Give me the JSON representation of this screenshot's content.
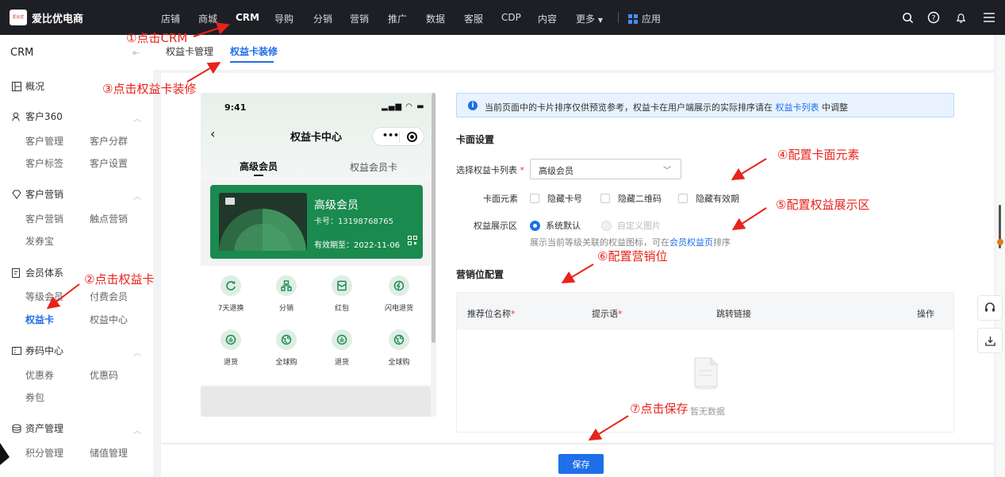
{
  "brand": {
    "logo_text": "爱比优",
    "name": "爱比优电商"
  },
  "topnav": {
    "items": [
      "店铺",
      "商城",
      "CRM",
      "导购",
      "分销",
      "营销",
      "推广",
      "数据",
      "客服",
      "CDP",
      "内容",
      "更多"
    ],
    "active": "CRM",
    "apps_label": "应用",
    "icons": [
      "search-icon",
      "help-icon",
      "bell-icon",
      "menu-icon"
    ]
  },
  "sidebar": {
    "title": "CRM",
    "groups": [
      {
        "label": "概况",
        "icon": "dashboard-icon",
        "items": []
      },
      {
        "label": "客户360",
        "icon": "user-icon",
        "items": [
          "客户管理",
          "客户分群",
          "客户标签",
          "客户设置"
        ]
      },
      {
        "label": "客户营销",
        "icon": "diamond-icon",
        "items": [
          "客户营销",
          "触点营销",
          "发券宝"
        ]
      },
      {
        "label": "会员体系",
        "icon": "member-icon",
        "items": [
          "等级会员",
          "付费会员",
          "权益卡",
          "权益中心"
        ]
      },
      {
        "label": "券码中心",
        "icon": "coupon-icon",
        "items": [
          "优惠券",
          "优惠码",
          "券包"
        ]
      },
      {
        "label": "资产管理",
        "icon": "asset-icon",
        "items": [
          "积分管理",
          "储值管理"
        ]
      }
    ],
    "active_item": "权益卡"
  },
  "tabs": [
    "权益卡管理",
    "权益卡装修"
  ],
  "active_tab": "权益卡装修",
  "phone": {
    "time": "9:41",
    "title": "权益卡中心",
    "tabs": [
      "高级会员",
      "权益会员卡"
    ],
    "card": {
      "name": "高级会员",
      "number": "卡号：13198768765",
      "expiry": "有效期至：2022-11-06"
    },
    "benefits": [
      "7天退换",
      "分销",
      "红包",
      "闪电退货",
      "退货",
      "全球购",
      "退货",
      "全球购"
    ]
  },
  "notice": {
    "text": "当前页面中的卡片排序仅供预览参考，权益卡在用户端展示的实际排序请在",
    "link": "权益卡列表",
    "suffix": "中调整"
  },
  "card_settings": {
    "title": "卡面设置",
    "select_label": "选择权益卡列表",
    "select_value": "高级会员",
    "elements_label": "卡面元素",
    "elements": [
      "隐藏卡号",
      "隐藏二维码",
      "隐藏有效期"
    ],
    "display_label": "权益展示区",
    "display_options": [
      "系统默认",
      "自定义图片"
    ],
    "display_selected": "系统默认",
    "hint_prefix": "展示当前等级关联的权益图标，可在",
    "hint_link": "会员权益页",
    "hint_suffix": "排序"
  },
  "marketing": {
    "title": "营销位配置",
    "columns": [
      "推荐位名称",
      "提示语",
      "跳转链接",
      "操作"
    ],
    "empty_text": "暂无数据"
  },
  "save_label": "保存",
  "annotations": [
    "①点击CRM",
    "②点击权益卡",
    "③点击权益卡装修",
    "④配置卡面元素",
    "⑤配置权益展示区",
    "⑥配置营销位",
    "⑦点击保存"
  ],
  "colors": {
    "accent": "#1e6fe8",
    "annotation": "#e8231a",
    "card_green": "#1a8a4f",
    "topbar": "#1e1f24"
  }
}
